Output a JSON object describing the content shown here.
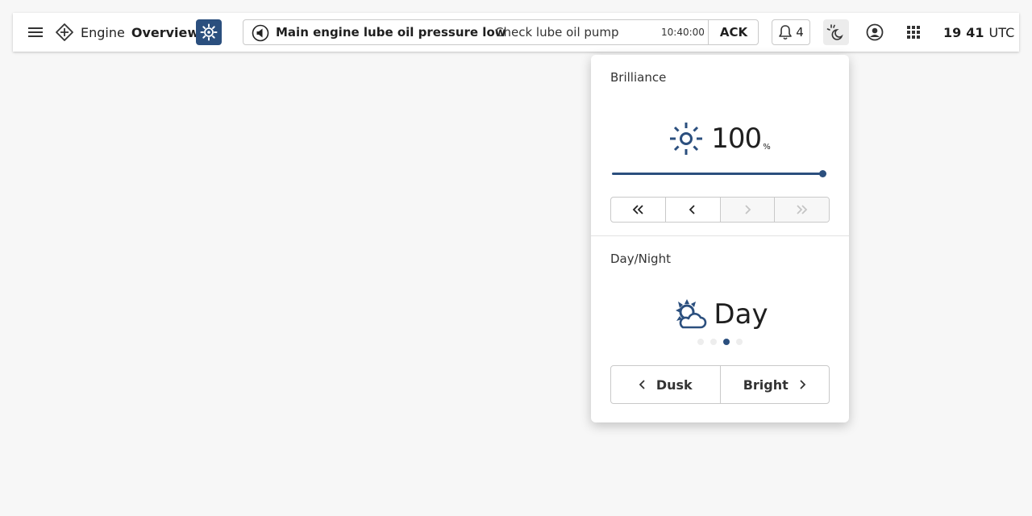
{
  "header": {
    "title_part1": "Engine",
    "title_part2": "Overview",
    "accent_color": "#2b4f7e"
  },
  "alert": {
    "title": "Main engine lube oil pressure low",
    "message": "Check lube oil pump",
    "time": "10:40:00",
    "ack_label": "ACK",
    "icon": "alert-speaker-icon"
  },
  "notifications": {
    "count": "4",
    "icon": "bell-icon"
  },
  "clock": {
    "hours": "19",
    "minutes": "41",
    "zone": "UTC"
  },
  "brilliance_panel": {
    "title": "Brilliance",
    "value": "100",
    "unit": "%",
    "slider_level_percent": 100,
    "stepper_states": [
      "enabled",
      "enabled",
      "disabled",
      "disabled"
    ],
    "icons": [
      "double-chevron-left-icon",
      "chevron-left-icon",
      "chevron-right-icon",
      "double-chevron-right-icon"
    ]
  },
  "daynight_panel": {
    "title": "Day/Night",
    "mode": "Day",
    "mode_index": 2,
    "mode_count": 4,
    "prev_label": "Dusk",
    "next_label": "Bright"
  }
}
